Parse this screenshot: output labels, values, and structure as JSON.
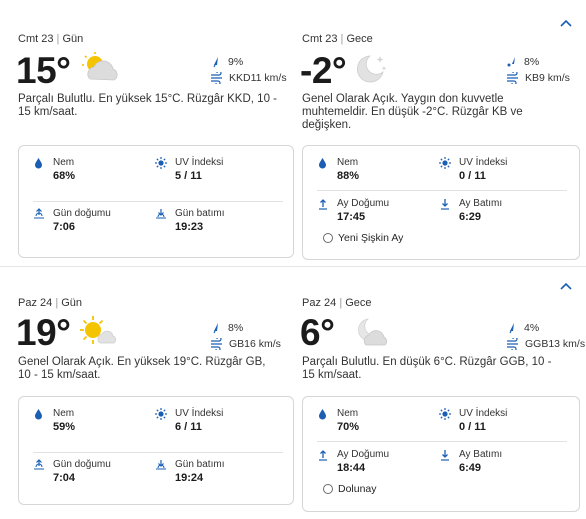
{
  "colors": {
    "accent": "#1a5fb4",
    "text": "#262626",
    "border": "#d6d6d6"
  },
  "days": [
    {
      "day": {
        "header_date": "Cmt 23",
        "header_period": "Gün",
        "temp": "15°",
        "icon": "partly-cloudy-icon",
        "precip": "9%",
        "wind": "KKD11 km/s",
        "description": "Parçalı Bulutlu. En yüksek 15°C. Rüzgâr KKD, 10 - 15 km/saat.",
        "humidity_label": "Nem",
        "humidity": "68%",
        "uv_label": "UV İndeksi",
        "uv": "5 / 11",
        "rise_label": "Gün doğumu",
        "rise": "7:06",
        "set_label": "Gün batımı",
        "set": "19:23"
      },
      "night": {
        "header_date": "Cmt 23",
        "header_period": "Gece",
        "temp": "-2°",
        "icon": "clear-night-moon-icon",
        "precip": "8%",
        "wind": "KB9 km/s",
        "description": "Genel Olarak Açık. Yaygın don kuvvetle muhtemeldir. En düşük -2°C. Rüzgâr KB ve değişken.",
        "humidity_label": "Nem",
        "humidity": "88%",
        "uv_label": "UV İndeksi",
        "uv": "0 / 11",
        "rise_label": "Ay Doğumu",
        "rise": "17:45",
        "set_label": "Ay Batımı",
        "set": "6:29",
        "moon_phase": "Yeni Şişkin Ay"
      }
    },
    {
      "day": {
        "header_date": "Paz 24",
        "header_period": "Gün",
        "temp": "19°",
        "icon": "mostly-sunny-icon",
        "precip": "8%",
        "wind": "GB16 km/s",
        "description": "Genel Olarak Açık. En yüksek 19°C. Rüzgâr GB, 10 - 15 km/saat.",
        "humidity_label": "Nem",
        "humidity": "59%",
        "uv_label": "UV İndeksi",
        "uv": "6 / 11",
        "rise_label": "Gün doğumu",
        "rise": "7:04",
        "set_label": "Gün batımı",
        "set": "19:24"
      },
      "night": {
        "header_date": "Paz 24",
        "header_period": "Gece",
        "temp": "6°",
        "icon": "partly-cloudy-night-icon",
        "precip": "4%",
        "wind": "GGB13 km/s",
        "description": "Parçalı Bulutlu. En düşük 6°C. Rüzgâr GGB, 10 - 15 km/saat.",
        "humidity_label": "Nem",
        "humidity": "70%",
        "uv_label": "UV İndeksi",
        "uv": "0 / 11",
        "rise_label": "Ay Doğumu",
        "rise": "18:44",
        "set_label": "Ay Batımı",
        "set": "6:49",
        "moon_phase": "Dolunay"
      }
    }
  ]
}
